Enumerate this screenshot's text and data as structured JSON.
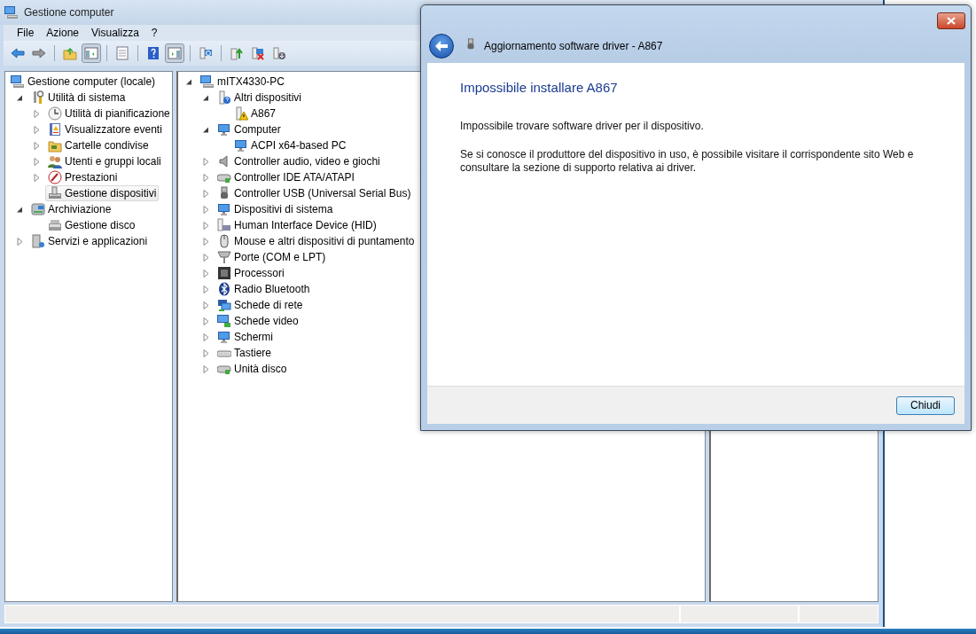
{
  "window": {
    "title": "Gestione computer"
  },
  "menu": [
    "File",
    "Azione",
    "Visualizza",
    "?"
  ],
  "left_tree": [
    {
      "label": "Gestione computer (locale)",
      "kind": "root",
      "selected": false,
      "children": [
        {
          "label": "Utilità di sistema",
          "kind": "folder",
          "expanded": true,
          "selected": false,
          "children": [
            {
              "label": "Utilità di pianificazione",
              "kind": "folder",
              "expanded": false,
              "selected": false
            },
            {
              "label": "Visualizzatore eventi",
              "kind": "folder",
              "expanded": false,
              "selected": false
            },
            {
              "label": "Cartelle condivise",
              "kind": "folder",
              "expanded": false,
              "selected": false
            },
            {
              "label": "Utenti e gruppi locali",
              "kind": "folder",
              "expanded": false,
              "selected": false
            },
            {
              "label": "Prestazioni",
              "kind": "folder",
              "expanded": false,
              "selected": false
            },
            {
              "label": "Gestione dispositivi",
              "kind": "leaf",
              "selected": true
            }
          ]
        },
        {
          "label": "Archiviazione",
          "kind": "folder",
          "expanded": true,
          "selected": false,
          "children": [
            {
              "label": "Gestione disco",
              "kind": "leaf",
              "selected": false
            }
          ]
        },
        {
          "label": "Servizi e applicazioni",
          "kind": "folder",
          "expanded": false,
          "selected": false
        }
      ]
    }
  ],
  "device_tree": [
    {
      "label": "mITX4330-PC",
      "kind": "folder",
      "expanded": true,
      "children": [
        {
          "label": "Altri dispositivi",
          "kind": "folder",
          "expanded": true,
          "children": [
            {
              "label": "A867",
              "kind": "leaf"
            }
          ]
        },
        {
          "label": "Computer",
          "kind": "folder",
          "expanded": true,
          "children": [
            {
              "label": "ACPI x64-based PC",
              "kind": "leaf"
            }
          ]
        },
        {
          "label": "Controller audio, video e giochi",
          "kind": "folder",
          "expanded": false
        },
        {
          "label": "Controller IDE ATA/ATAPI",
          "kind": "folder",
          "expanded": false
        },
        {
          "label": "Controller USB (Universal Serial Bus)",
          "kind": "folder",
          "expanded": false
        },
        {
          "label": "Dispositivi di sistema",
          "kind": "folder",
          "expanded": false
        },
        {
          "label": "Human Interface Device (HID)",
          "kind": "folder",
          "expanded": false
        },
        {
          "label": "Mouse e altri dispositivi di puntamento",
          "kind": "folder",
          "expanded": false
        },
        {
          "label": "Porte (COM e LPT)",
          "kind": "folder",
          "expanded": false
        },
        {
          "label": "Processori",
          "kind": "folder",
          "expanded": false
        },
        {
          "label": "Radio Bluetooth",
          "kind": "folder",
          "expanded": false
        },
        {
          "label": "Schede di rete",
          "kind": "folder",
          "expanded": false
        },
        {
          "label": "Schede video",
          "kind": "folder",
          "expanded": false
        },
        {
          "label": "Schermi",
          "kind": "folder",
          "expanded": false
        },
        {
          "label": "Tastiere",
          "kind": "folder",
          "expanded": false
        },
        {
          "label": "Unità disco",
          "kind": "folder",
          "expanded": false
        }
      ]
    }
  ],
  "dialog": {
    "title": "Aggiornamento software driver - A867",
    "heading": "Impossibile installare A867",
    "paragraphs": [
      "Impossibile trovare software driver per il dispositivo.",
      "Se si conosce il produttore del dispositivo in uso, è possibile visitare il corrispondente sito Web e consultare la sezione di supporto relativa ai driver."
    ],
    "button": "Chiudi"
  }
}
